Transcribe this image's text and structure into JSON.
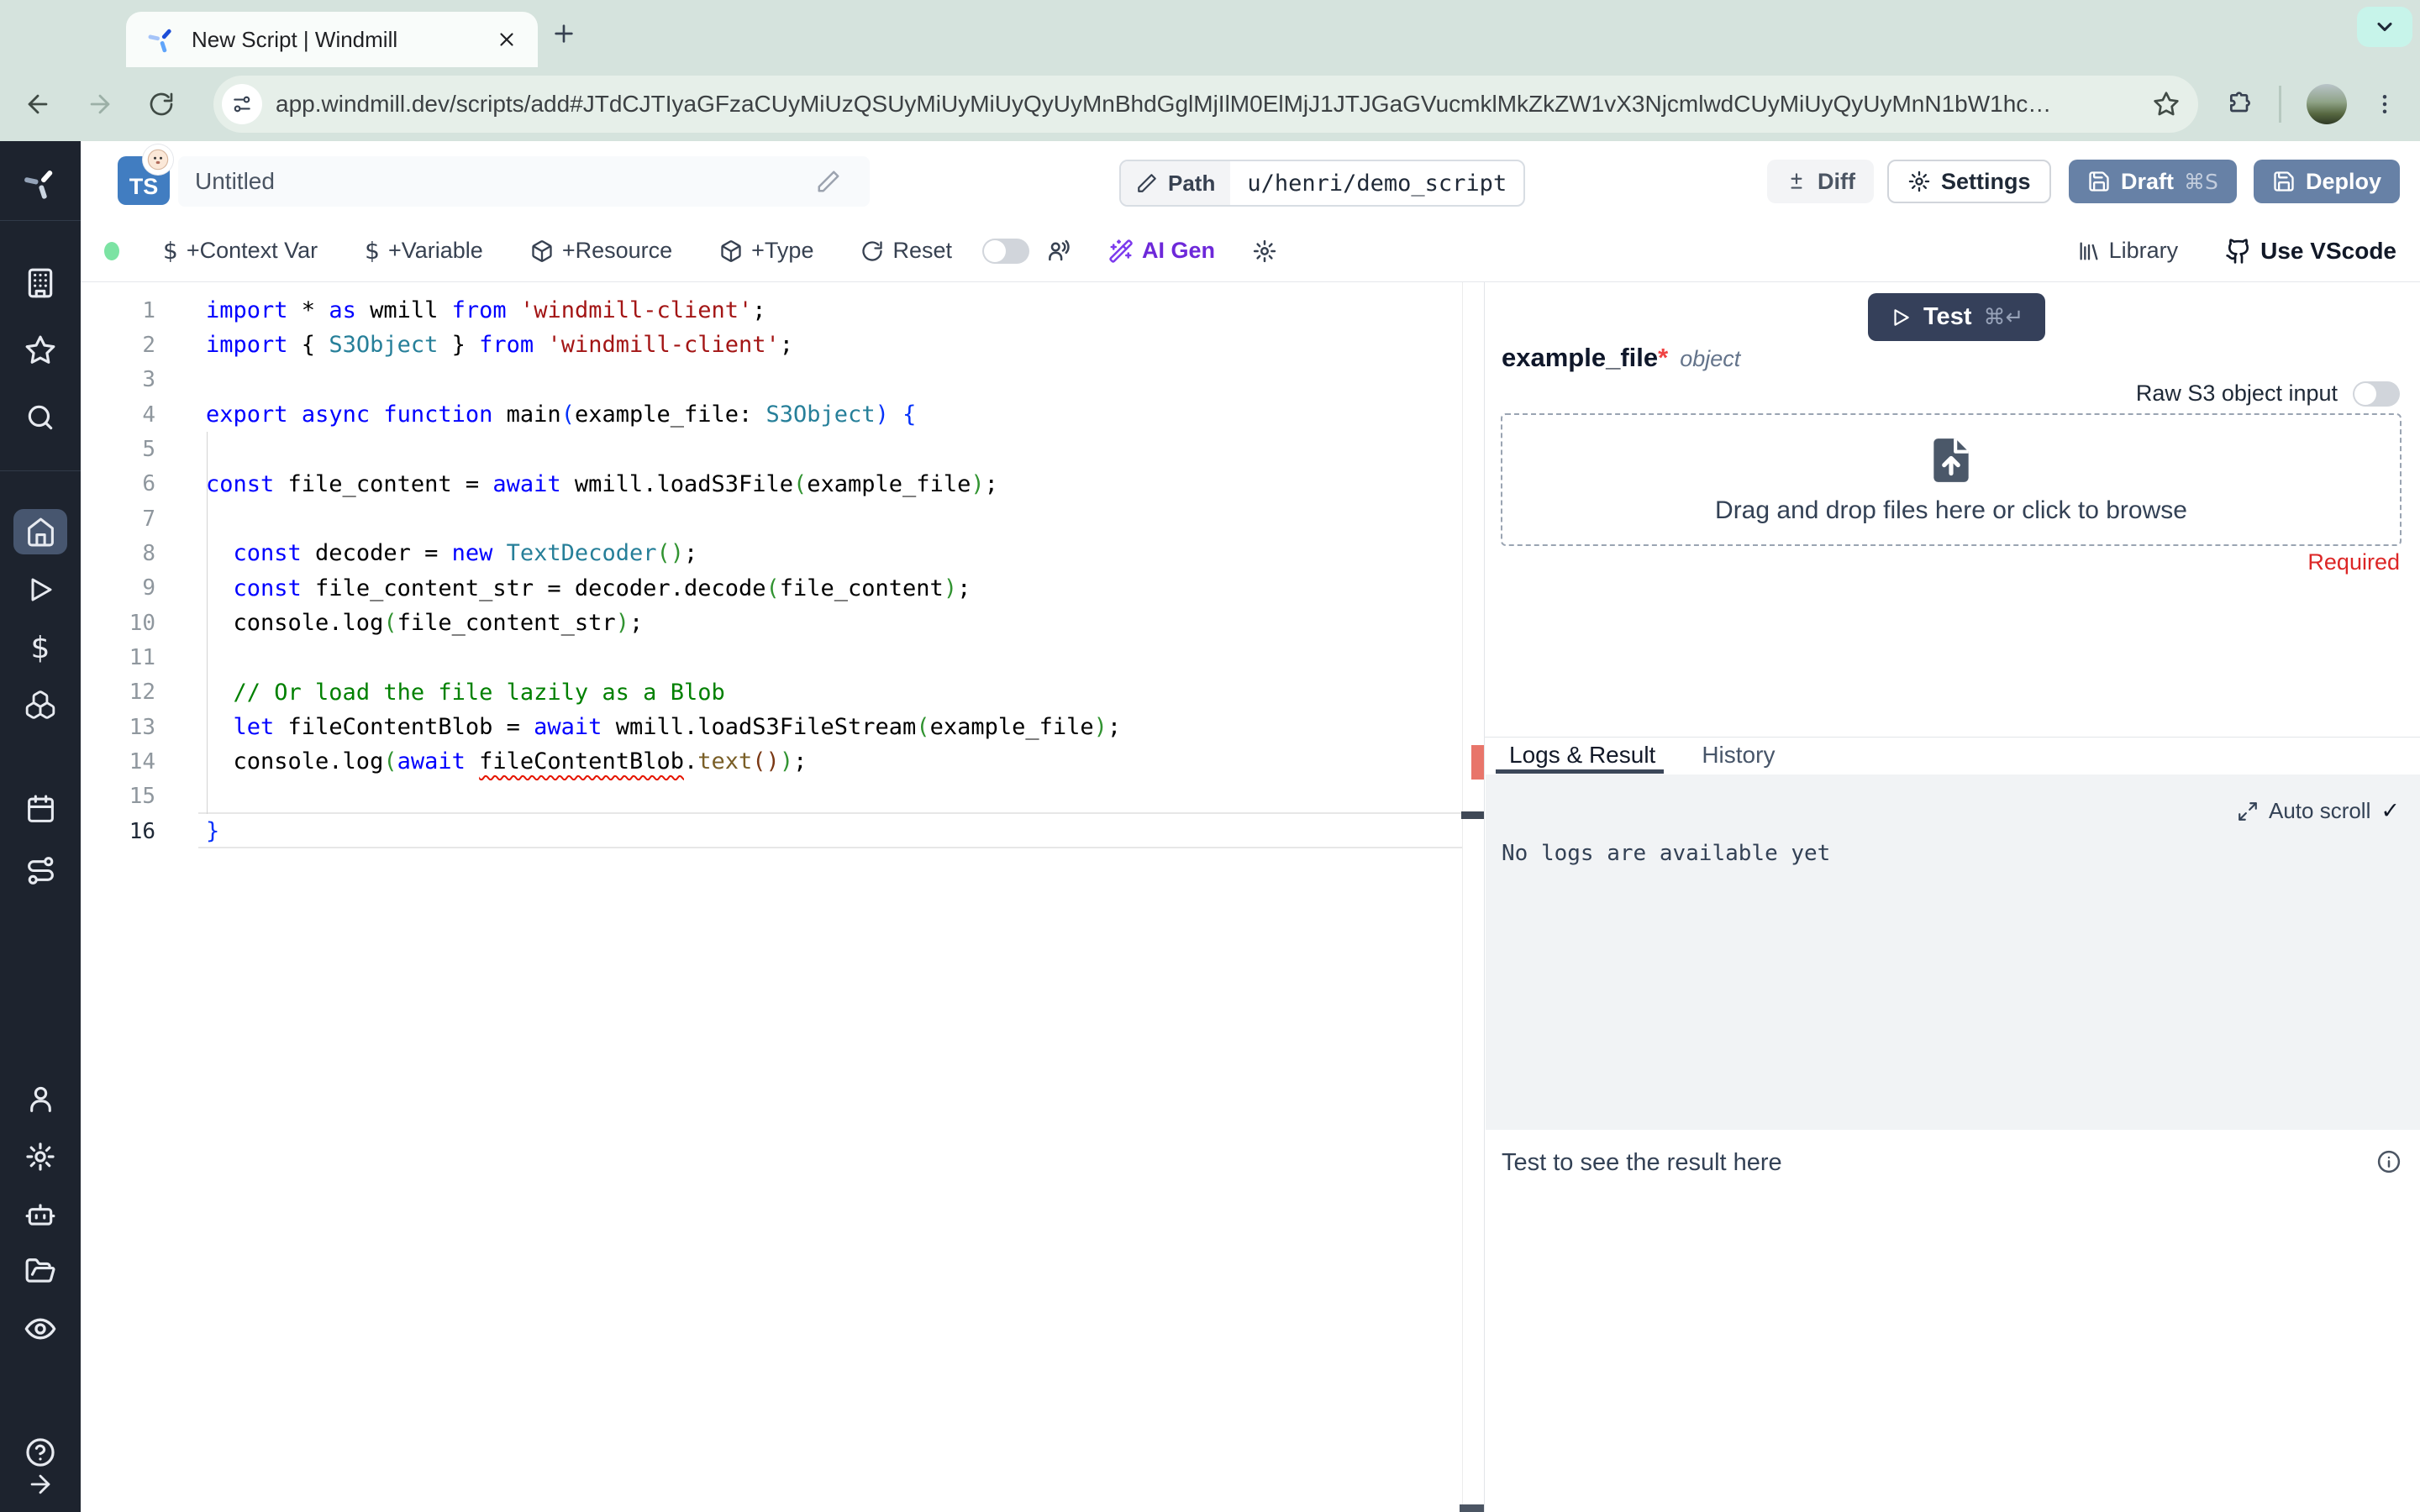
{
  "theme": {
    "chrome_bg": "#d5e3dd",
    "sidebar_bg": "#1d232e",
    "sidebar_active": "#47566f",
    "accent_blue": "#6781a6",
    "dark_navy": "#35405a",
    "ai_purple": "#6d28d9",
    "green_dot": "#7ce3a3",
    "required_red": "#dc2626",
    "error_red": "#e8756a",
    "keyword_blue": "#0000ff",
    "string_red": "#a31515",
    "type_teal": "#267f99",
    "comment_green": "#008000"
  },
  "browser": {
    "tab_title": "New Script | Windmill",
    "url": "app.windmill.dev/scripts/add#JTdCJTIyaGFzaCUyMiUzQSUyMiUyMiUyQyUyMnBhdGglMjIlM0ElMjJ1JTJGaGVucmklMkZkZW1vX3NjcmlwdCUyMiUyQyUyMnN1bW1hc…"
  },
  "sidebar": {
    "icons": [
      "windmill-logo",
      "workspace",
      "favorites",
      "search",
      "home",
      "runs",
      "variables",
      "resources",
      "schedules",
      "flows",
      "users",
      "settings",
      "workers",
      "folders",
      "audit-logs",
      "help",
      "expand"
    ],
    "dollar_glyph": "$"
  },
  "header": {
    "lang_badge": "TS",
    "title_value": "Untitled",
    "path_label": "Path",
    "path_value": "u/henri/demo_script",
    "diff_label": "Diff",
    "settings_label": "Settings",
    "draft_label": "Draft",
    "draft_shortcut": "⌘S",
    "deploy_label": "Deploy"
  },
  "toolbar": {
    "dollar_glyph": "$",
    "context_var_label": "+Context Var",
    "variable_label": "+Variable",
    "resource_label": "+Resource",
    "type_label": "+Type",
    "reset_label": "Reset",
    "ai_gen_label": "AI Gen",
    "library_label": "Library",
    "vscode_label": "Use VScode"
  },
  "editor": {
    "lines": [
      {
        "num": "1",
        "tokens": [
          [
            "kw",
            "import"
          ],
          [
            "pl",
            " * "
          ],
          [
            "kw",
            "as"
          ],
          [
            "pl",
            " wmill "
          ],
          [
            "kw",
            "from"
          ],
          [
            "pl",
            " "
          ],
          [
            "str",
            "'windmill-client'"
          ],
          [
            "pl",
            ";"
          ]
        ]
      },
      {
        "num": "2",
        "tokens": [
          [
            "kw",
            "import"
          ],
          [
            "pl",
            " { "
          ],
          [
            "typ",
            "S3Object"
          ],
          [
            "pl",
            " } "
          ],
          [
            "kw",
            "from"
          ],
          [
            "pl",
            " "
          ],
          [
            "str",
            "'windmill-client'"
          ],
          [
            "pl",
            ";"
          ]
        ]
      },
      {
        "num": "3",
        "tokens": []
      },
      {
        "num": "4",
        "tokens": [
          [
            "kw",
            "export"
          ],
          [
            "pl",
            " "
          ],
          [
            "kw",
            "async"
          ],
          [
            "pl",
            " "
          ],
          [
            "kw",
            "function"
          ],
          [
            "pl",
            " main"
          ],
          [
            "b1",
            "("
          ],
          [
            "pl",
            "example_file: "
          ],
          [
            "typ",
            "S3Object"
          ],
          [
            "b1",
            ")"
          ],
          [
            "pl",
            " "
          ],
          [
            "b1",
            "{"
          ]
        ]
      },
      {
        "num": "5",
        "tokens": []
      },
      {
        "num": "6",
        "tokens": [
          [
            "kw",
            "const"
          ],
          [
            "pl",
            " file_content = "
          ],
          [
            "kw",
            "await"
          ],
          [
            "pl",
            " wmill.loadS3File"
          ],
          [
            "b2",
            "("
          ],
          [
            "pl",
            "example_file"
          ],
          [
            "b2",
            ")"
          ],
          [
            "pl",
            ";"
          ]
        ]
      },
      {
        "num": "7",
        "tokens": []
      },
      {
        "num": "8",
        "tokens": [
          [
            "pl",
            "  "
          ],
          [
            "kw",
            "const"
          ],
          [
            "pl",
            " decoder = "
          ],
          [
            "kw",
            "new"
          ],
          [
            "pl",
            " "
          ],
          [
            "typ",
            "TextDecoder"
          ],
          [
            "b2",
            "("
          ],
          [
            "b2",
            ")"
          ],
          [
            "pl",
            ";"
          ]
        ]
      },
      {
        "num": "9",
        "tokens": [
          [
            "pl",
            "  "
          ],
          [
            "kw",
            "const"
          ],
          [
            "pl",
            " file_content_str = decoder.decode"
          ],
          [
            "b2",
            "("
          ],
          [
            "pl",
            "file_content"
          ],
          [
            "b2",
            ")"
          ],
          [
            "pl",
            ";"
          ]
        ]
      },
      {
        "num": "10",
        "tokens": [
          [
            "pl",
            "  console.log"
          ],
          [
            "b2",
            "("
          ],
          [
            "pl",
            "file_content_str"
          ],
          [
            "b2",
            ")"
          ],
          [
            "pl",
            ";"
          ]
        ]
      },
      {
        "num": "11",
        "tokens": []
      },
      {
        "num": "12",
        "tokens": [
          [
            "pl",
            "  "
          ],
          [
            "com",
            "// Or load the file lazily as a Blob"
          ]
        ]
      },
      {
        "num": "13",
        "tokens": [
          [
            "pl",
            "  "
          ],
          [
            "kw",
            "let"
          ],
          [
            "pl",
            " fileContentBlob = "
          ],
          [
            "kw",
            "await"
          ],
          [
            "pl",
            " wmill.loadS3FileStream"
          ],
          [
            "b2",
            "("
          ],
          [
            "pl",
            "example_file"
          ],
          [
            "b2",
            ")"
          ],
          [
            "pl",
            ";"
          ]
        ]
      },
      {
        "num": "14",
        "tokens": [
          [
            "pl",
            "  console.log"
          ],
          [
            "b2",
            "("
          ],
          [
            "kw",
            "await"
          ],
          [
            "pl",
            " "
          ],
          [
            "err",
            "fileContentBlob"
          ],
          [
            "pl",
            "."
          ],
          [
            "mth",
            "text"
          ],
          [
            "b3",
            "("
          ],
          [
            "b3",
            ")"
          ],
          [
            "b2",
            ")"
          ],
          [
            "pl",
            ";"
          ]
        ]
      },
      {
        "num": "15",
        "tokens": []
      },
      {
        "num": "16",
        "active": true,
        "tokens": [
          [
            "b1",
            "}"
          ]
        ]
      }
    ]
  },
  "right_panel": {
    "test_label": "Test",
    "test_shortcut": "⌘↵",
    "arg_name": "example_file",
    "arg_required_mark": "*",
    "arg_type": "object",
    "raw_s3_label": "Raw S3 object input",
    "dropzone_text": "Drag and drop files here or click to browse",
    "required_label": "Required",
    "tab_logs": "Logs & Result",
    "tab_history": "History",
    "auto_scroll_label": "Auto scroll",
    "auto_scroll_check": "✓",
    "no_logs_text": "No logs are available yet",
    "result_placeholder": "Test to see the result here"
  }
}
